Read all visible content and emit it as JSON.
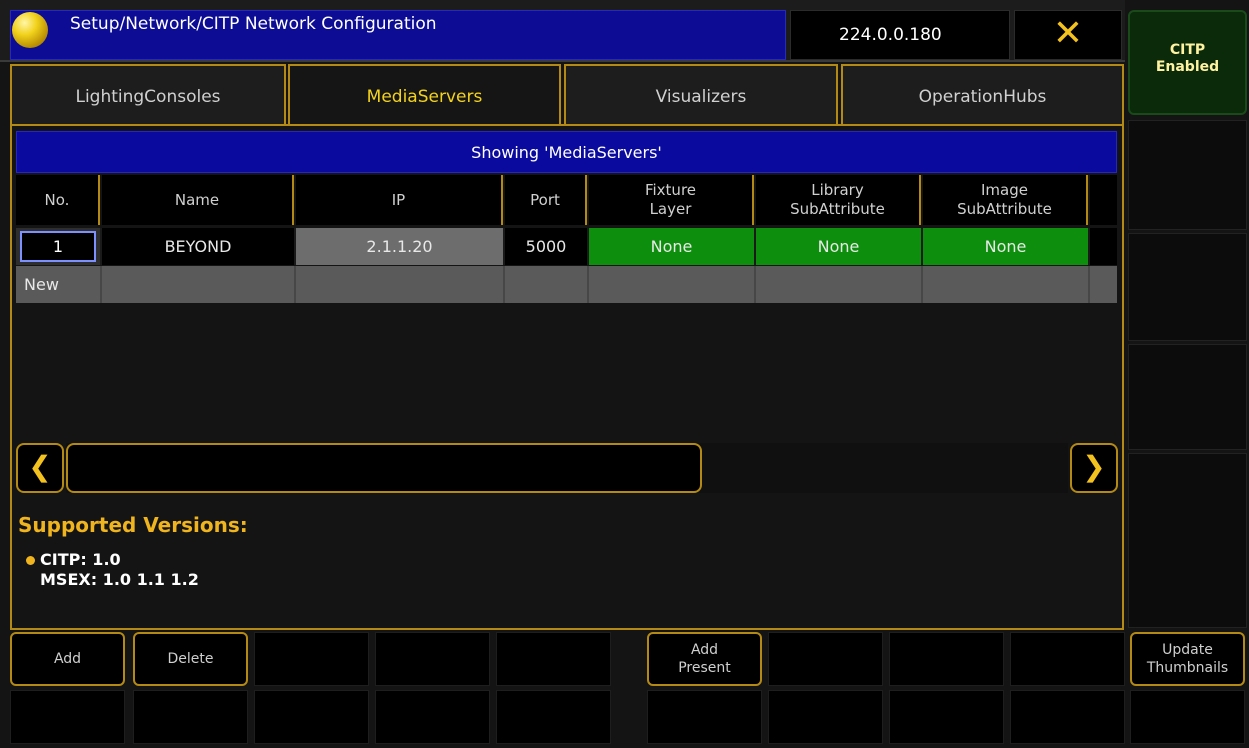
{
  "title_bar": {
    "title": "Setup/Network/CITP Network Configuration",
    "ip": "224.0.0.180",
    "close_icon": "close-icon"
  },
  "tabs": [
    {
      "label": "LightingConsoles",
      "active": false
    },
    {
      "label": "MediaServers",
      "active": true
    },
    {
      "label": "Visualizers",
      "active": false
    },
    {
      "label": "OperationHubs",
      "active": false
    }
  ],
  "banner": "Showing 'MediaServers'",
  "table": {
    "headers": [
      [
        "No."
      ],
      [
        "Name"
      ],
      [
        "IP"
      ],
      [
        "Port"
      ],
      [
        "Fixture",
        "Layer"
      ],
      [
        "Library",
        "SubAttribute"
      ],
      [
        "Image",
        "SubAttribute"
      ]
    ],
    "rows": [
      {
        "no": "1",
        "name": "BEYOND",
        "ip": "2.1.1.20",
        "port": "5000",
        "fixture_layer": "None",
        "library_subattribute": "None",
        "image_subattribute": "None"
      }
    ],
    "new_row_label": "New"
  },
  "supported_versions": {
    "title": "Supported Versions:",
    "citp": "CITP: 1.0",
    "msex": "MSEX: 1.0 1.1 1.2"
  },
  "side": {
    "citp_button": [
      "CITP",
      "Enabled"
    ]
  },
  "bottom_buttons": {
    "add": "Add",
    "delete": "Delete",
    "add_present": [
      "Add",
      "Present"
    ],
    "update_thumbnails": [
      "Update",
      "Thumbnails"
    ]
  },
  "colors": {
    "accent": "#b48a14",
    "title_blue": "#0c0c94",
    "cell_green": "#0d8f0d",
    "highlight_yellow": "#f3d21e"
  }
}
